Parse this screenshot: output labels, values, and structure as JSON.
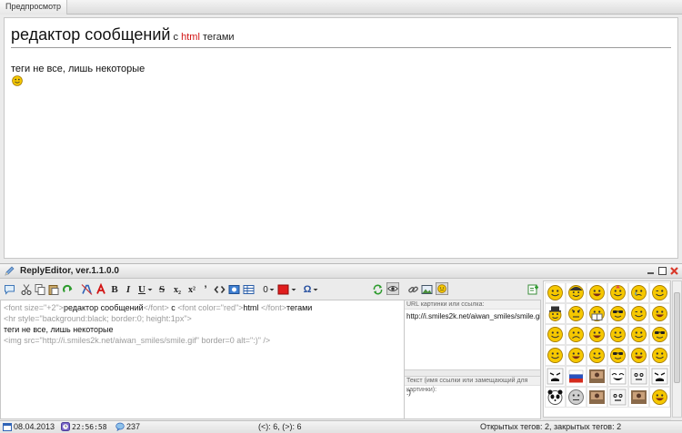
{
  "preview": {
    "tab_label": "Предпросмотр",
    "heading_big": "редактор сообщений",
    "heading_mid": "с",
    "heading_red": "html",
    "heading_end": "тегами",
    "text_line": "теги не все, лишь некоторые"
  },
  "editor": {
    "title": "ReplyEditor, ver.1.1.0.0",
    "toolbar": {
      "bold": "B",
      "italic": "I",
      "underline": "U",
      "strike": "S",
      "sub": "x₂",
      "sup": "x²",
      "quote": "’",
      "size_value": "0",
      "omega": "Ω"
    },
    "code": {
      "line1": {
        "t1": "<font size=\"+2\">",
        "t2": "редактор сообщений",
        "t3": "</font>",
        "t4": " с ",
        "t5": "<font color=\"red\">",
        "t6": "html ",
        "t7": "</font>",
        "t8": "тегами"
      },
      "line2": "<hr style=\"background:black; border:0; height:1px\">",
      "line3": "теги не все, лишь некоторые",
      "line4": "<img src=\"http://i.smiles2k.net/aiwan_smiles/smile.gif\" border=0 alt=\":)\" />"
    },
    "image_panel": {
      "url_label": "URL картинки или ссылка:",
      "url_value": "http://i.smiles2k.net/aiwan_smiles/smile.gif",
      "alt_label": "Текст (имя ссылки или замещающий для картинки):",
      "alt_value": ":)"
    }
  },
  "status": {
    "date": "08.04.2013",
    "time": "22:56:58",
    "count": "237",
    "cursor": "(<): 6, (>): 6",
    "tags": "Открытых тегов: 2, закрытых тегов: 2"
  },
  "colors": {
    "accent_red": "#d21414",
    "smile_yellow": "#f6c800",
    "tag_gray": "#9c9c9c"
  },
  "smiles": {
    "icons": [
      "smile-icon",
      "sunglasses-smile-icon",
      "laugh-smile-icon",
      "angry-smile-icon",
      "sad-smile-icon",
      "wink-smile-icon",
      "gray-face-icon",
      "rage-face-icon",
      "troll-face-icon",
      "meme-face-icon"
    ]
  }
}
